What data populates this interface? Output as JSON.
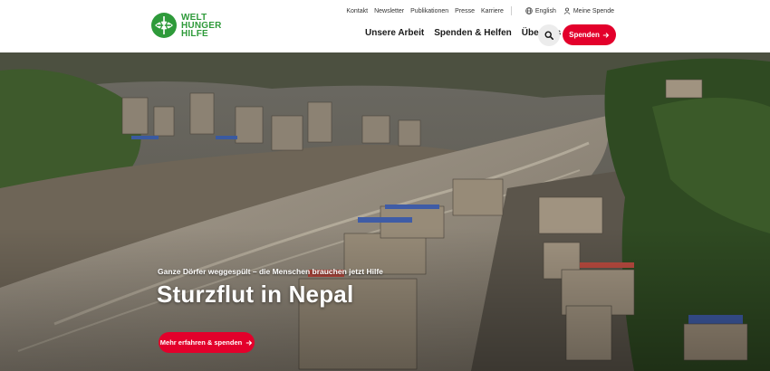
{
  "logo": {
    "line1": "WELT",
    "line2": "HUNGER",
    "line3": "HILFE",
    "icon": "globe-leaf-icon"
  },
  "topnav": {
    "items": [
      "Kontakt",
      "Newsletter",
      "Publikationen",
      "Presse",
      "Karriere"
    ],
    "language": {
      "icon": "globe-icon",
      "label": "English"
    },
    "account": {
      "icon": "user-icon",
      "label": "Meine Spende"
    }
  },
  "mainnav": {
    "items": [
      "Unsere Arbeit",
      "Spenden & Helfen",
      "Über uns"
    ]
  },
  "search": {
    "icon": "search-icon"
  },
  "donate_button": {
    "label": "Spenden",
    "icon": "arrow-right-icon"
  },
  "hero": {
    "subline": "Ganze Dörfer weggespült – die Menschen brauchen jetzt Hilfe",
    "headline": "Sturzflut in Nepal",
    "cta_label": "Mehr erfahren & spenden",
    "cta_icon": "arrow-right-icon"
  },
  "colors": {
    "brand_green": "#2e9a3a",
    "accent_red": "#e3002b"
  }
}
